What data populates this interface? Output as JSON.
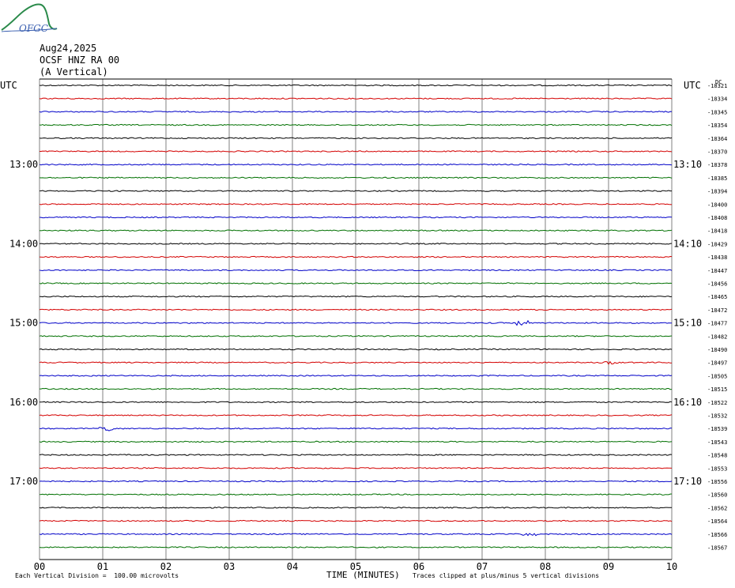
{
  "header": {
    "logo_text": "OFGC",
    "date": "Aug24,2025",
    "station": "OCSF HNZ RA 00",
    "component": "(A Vertical)"
  },
  "colors": {
    "trace_cycle": [
      "#000000",
      "#d40000",
      "#0000c8",
      "#007000"
    ],
    "grid": "#808080",
    "logo_green": "#2a8a4a",
    "logo_blue": "#3a5fb0"
  },
  "chart_data": {
    "type": "line",
    "title": "",
    "xlabel": "TIME (MINUTES)",
    "ylabel": "",
    "x_ticks": [
      "00",
      "01",
      "02",
      "03",
      "04",
      "05",
      "06",
      "07",
      "08",
      "09",
      "10"
    ],
    "xlim": [
      0,
      10
    ],
    "left_top_label": "UTC",
    "right_top_label": "UTC",
    "left_hour_labels": [
      {
        "row": 6,
        "text": "13:00"
      },
      {
        "row": 12,
        "text": "14:00"
      },
      {
        "row": 18,
        "text": "15:00"
      },
      {
        "row": 24,
        "text": "16:00"
      },
      {
        "row": 30,
        "text": "17:00"
      }
    ],
    "right_hour_labels": [
      {
        "row": 6,
        "text": "13:10"
      },
      {
        "row": 12,
        "text": "14:10"
      },
      {
        "row": 18,
        "text": "15:10"
      },
      {
        "row": 24,
        "text": "16:10"
      },
      {
        "row": 30,
        "text": "17:10"
      }
    ],
    "dc_label": "DC",
    "trace_offsets": [
      "-18321",
      "-18334",
      "-18345",
      "-18354",
      "-18364",
      "-18370",
      "-18378",
      "-18385",
      "-18394",
      "-18400",
      "-18408",
      "-18418",
      "-18429",
      "-18438",
      "-18447",
      "-18456",
      "-18465",
      "-18472",
      "-18477",
      "-18482",
      "-18490",
      "-18497",
      "-18505",
      "-18515",
      "-18522",
      "-18532",
      "-18539",
      "-18543",
      "-18548",
      "-18553",
      "-18556",
      "-18560",
      "-18562",
      "-18564",
      "-18566",
      "-18567"
    ],
    "events": [
      {
        "row": 18,
        "x_minutes": 7.65,
        "amplitude": 3
      },
      {
        "row": 21,
        "x_minutes": 9.05,
        "amplitude": 2
      },
      {
        "row": 26,
        "x_minutes": 1.05,
        "amplitude": 3
      },
      {
        "row": 34,
        "x_minutes": 7.75,
        "amplitude": 2
      }
    ],
    "footer_scale_note": "Each Vertical Division =  100.00 microvolts",
    "footer_clip_note": "Traces clipped at plus/minus 5 vertical divisions"
  }
}
